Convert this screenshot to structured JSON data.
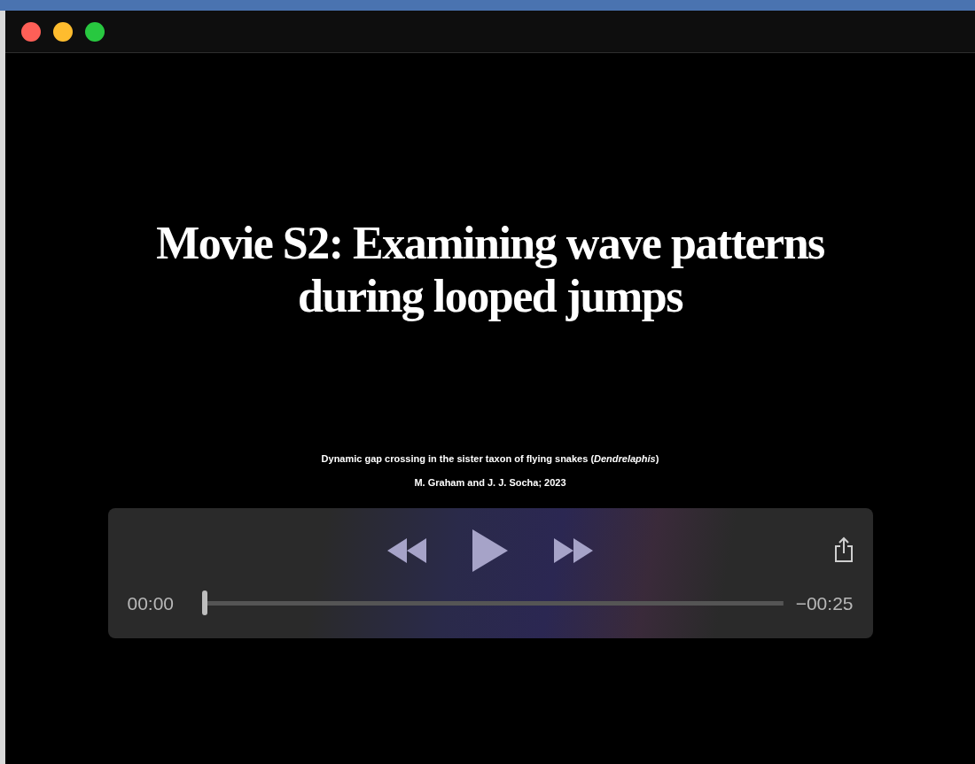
{
  "window": {
    "buttons": [
      {
        "kind": "close"
      },
      {
        "kind": "minimize"
      },
      {
        "kind": "zoom"
      }
    ]
  },
  "video_frame": {
    "title": "Movie S2: Examining wave patterns during looped jumps",
    "subtitle": "Dynamic gap crossing in the sister taxon of flying snakes (*Dendrelaphis*)",
    "credit": "M. Graham and J. J. Socha; 2023"
  },
  "controls": {
    "playing": false,
    "elapsed": "00:00",
    "remaining": "−00:25",
    "level": 0
  }
}
